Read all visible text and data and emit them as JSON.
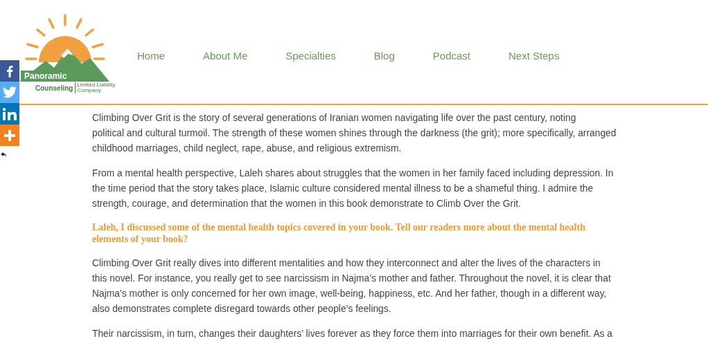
{
  "logo": {
    "name": "Panoramic",
    "subname": "Counseling",
    "tagline": "Limited Liability Company"
  },
  "nav": [
    {
      "label": "Home"
    },
    {
      "label": "About Me"
    },
    {
      "label": "Specialties"
    },
    {
      "label": "Blog"
    },
    {
      "label": "Podcast"
    },
    {
      "label": "Next Steps"
    }
  ],
  "share": [
    {
      "kind": "facebook",
      "color": "#3b5998"
    },
    {
      "kind": "twitter",
      "color": "#55acee"
    },
    {
      "kind": "linkedin",
      "color": "#0077b5"
    },
    {
      "kind": "more",
      "color": "#f48120"
    }
  ],
  "content": [
    {
      "kind": "paragraph",
      "lines": [
        "Climbing Over Grit is the story of several generations of Iranian women navigating life over the past century, noting",
        "political and cultural turmoil. The strength of these women shines through the darkness (the grit); more specifically, arranged",
        "childhood marriages, child neglect, rape, abuse, and religious extremism."
      ]
    },
    {
      "kind": "paragraph",
      "lines": [
        "From a mental health perspective, Laleh shares about struggles that the women in her family faced including depression. In",
        "the time period that the story takes place, Islamic culture considered mental illness to be a shameful thing. I admire the",
        "strength, courage, and determination that the women in this book demonstrate to Climb Over the Grit."
      ]
    },
    {
      "kind": "question",
      "lines": [
        "Laleh, I discussed some of the mental health topics covered in your book. Tell our readers more about the mental health",
        "elements of your book?"
      ]
    },
    {
      "kind": "paragraph",
      "lines": [
        "Climbing Over Grit really dives into different mentalities and how they interconnect and alter the lives of the characters in",
        "this novel. For instance, you really get to see narcissism in Najma’s mother and father. Throughout the novel, it is clear that",
        "Najma’s mother is only concerned for her own image, well-being, happiness, etc. And her father, though in a different way,",
        "also demonstrates complete disregard towards other people’s feelings."
      ]
    },
    {
      "kind": "paragraph",
      "lines": [
        "Their narcissism, in turn, changes their daughters’ lives forever as they force them into marriages for their own benefit. As a"
      ]
    }
  ]
}
